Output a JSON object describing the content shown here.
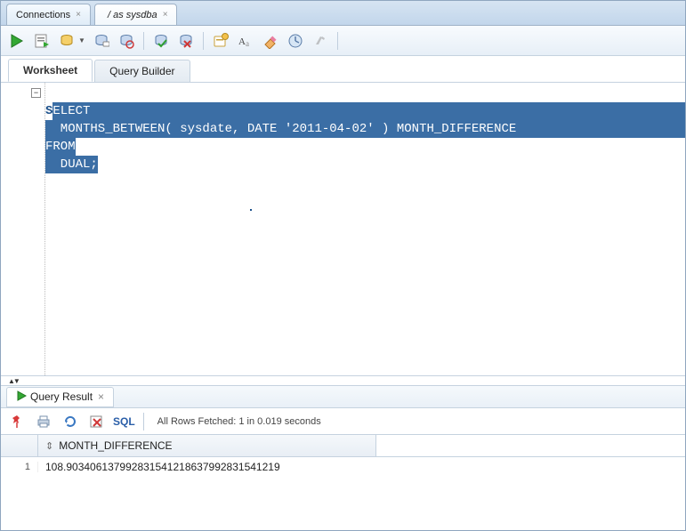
{
  "topTabs": {
    "connections": "Connections",
    "active": "/ as sysdba"
  },
  "wsTabs": {
    "worksheet": "Worksheet",
    "queryBuilder": "Query Builder"
  },
  "code": {
    "l1_pre": "S",
    "l1_rest": "ELECT",
    "l2": "  MONTHS_BETWEEN( sysdate, DATE '2011-04-02' ) MONTH_DIFFERENCE",
    "l3": "FROM",
    "l4": "  DUAL;"
  },
  "resultTab": "Query Result",
  "sqlLink": "SQL",
  "status": "All Rows Fetched: 1 in 0.019 seconds",
  "grid": {
    "col1": "MONTH_DIFFERENCE",
    "row1num": "1",
    "row1val": "108.903406137992831541218637992831541219"
  },
  "foldMinus": "−"
}
